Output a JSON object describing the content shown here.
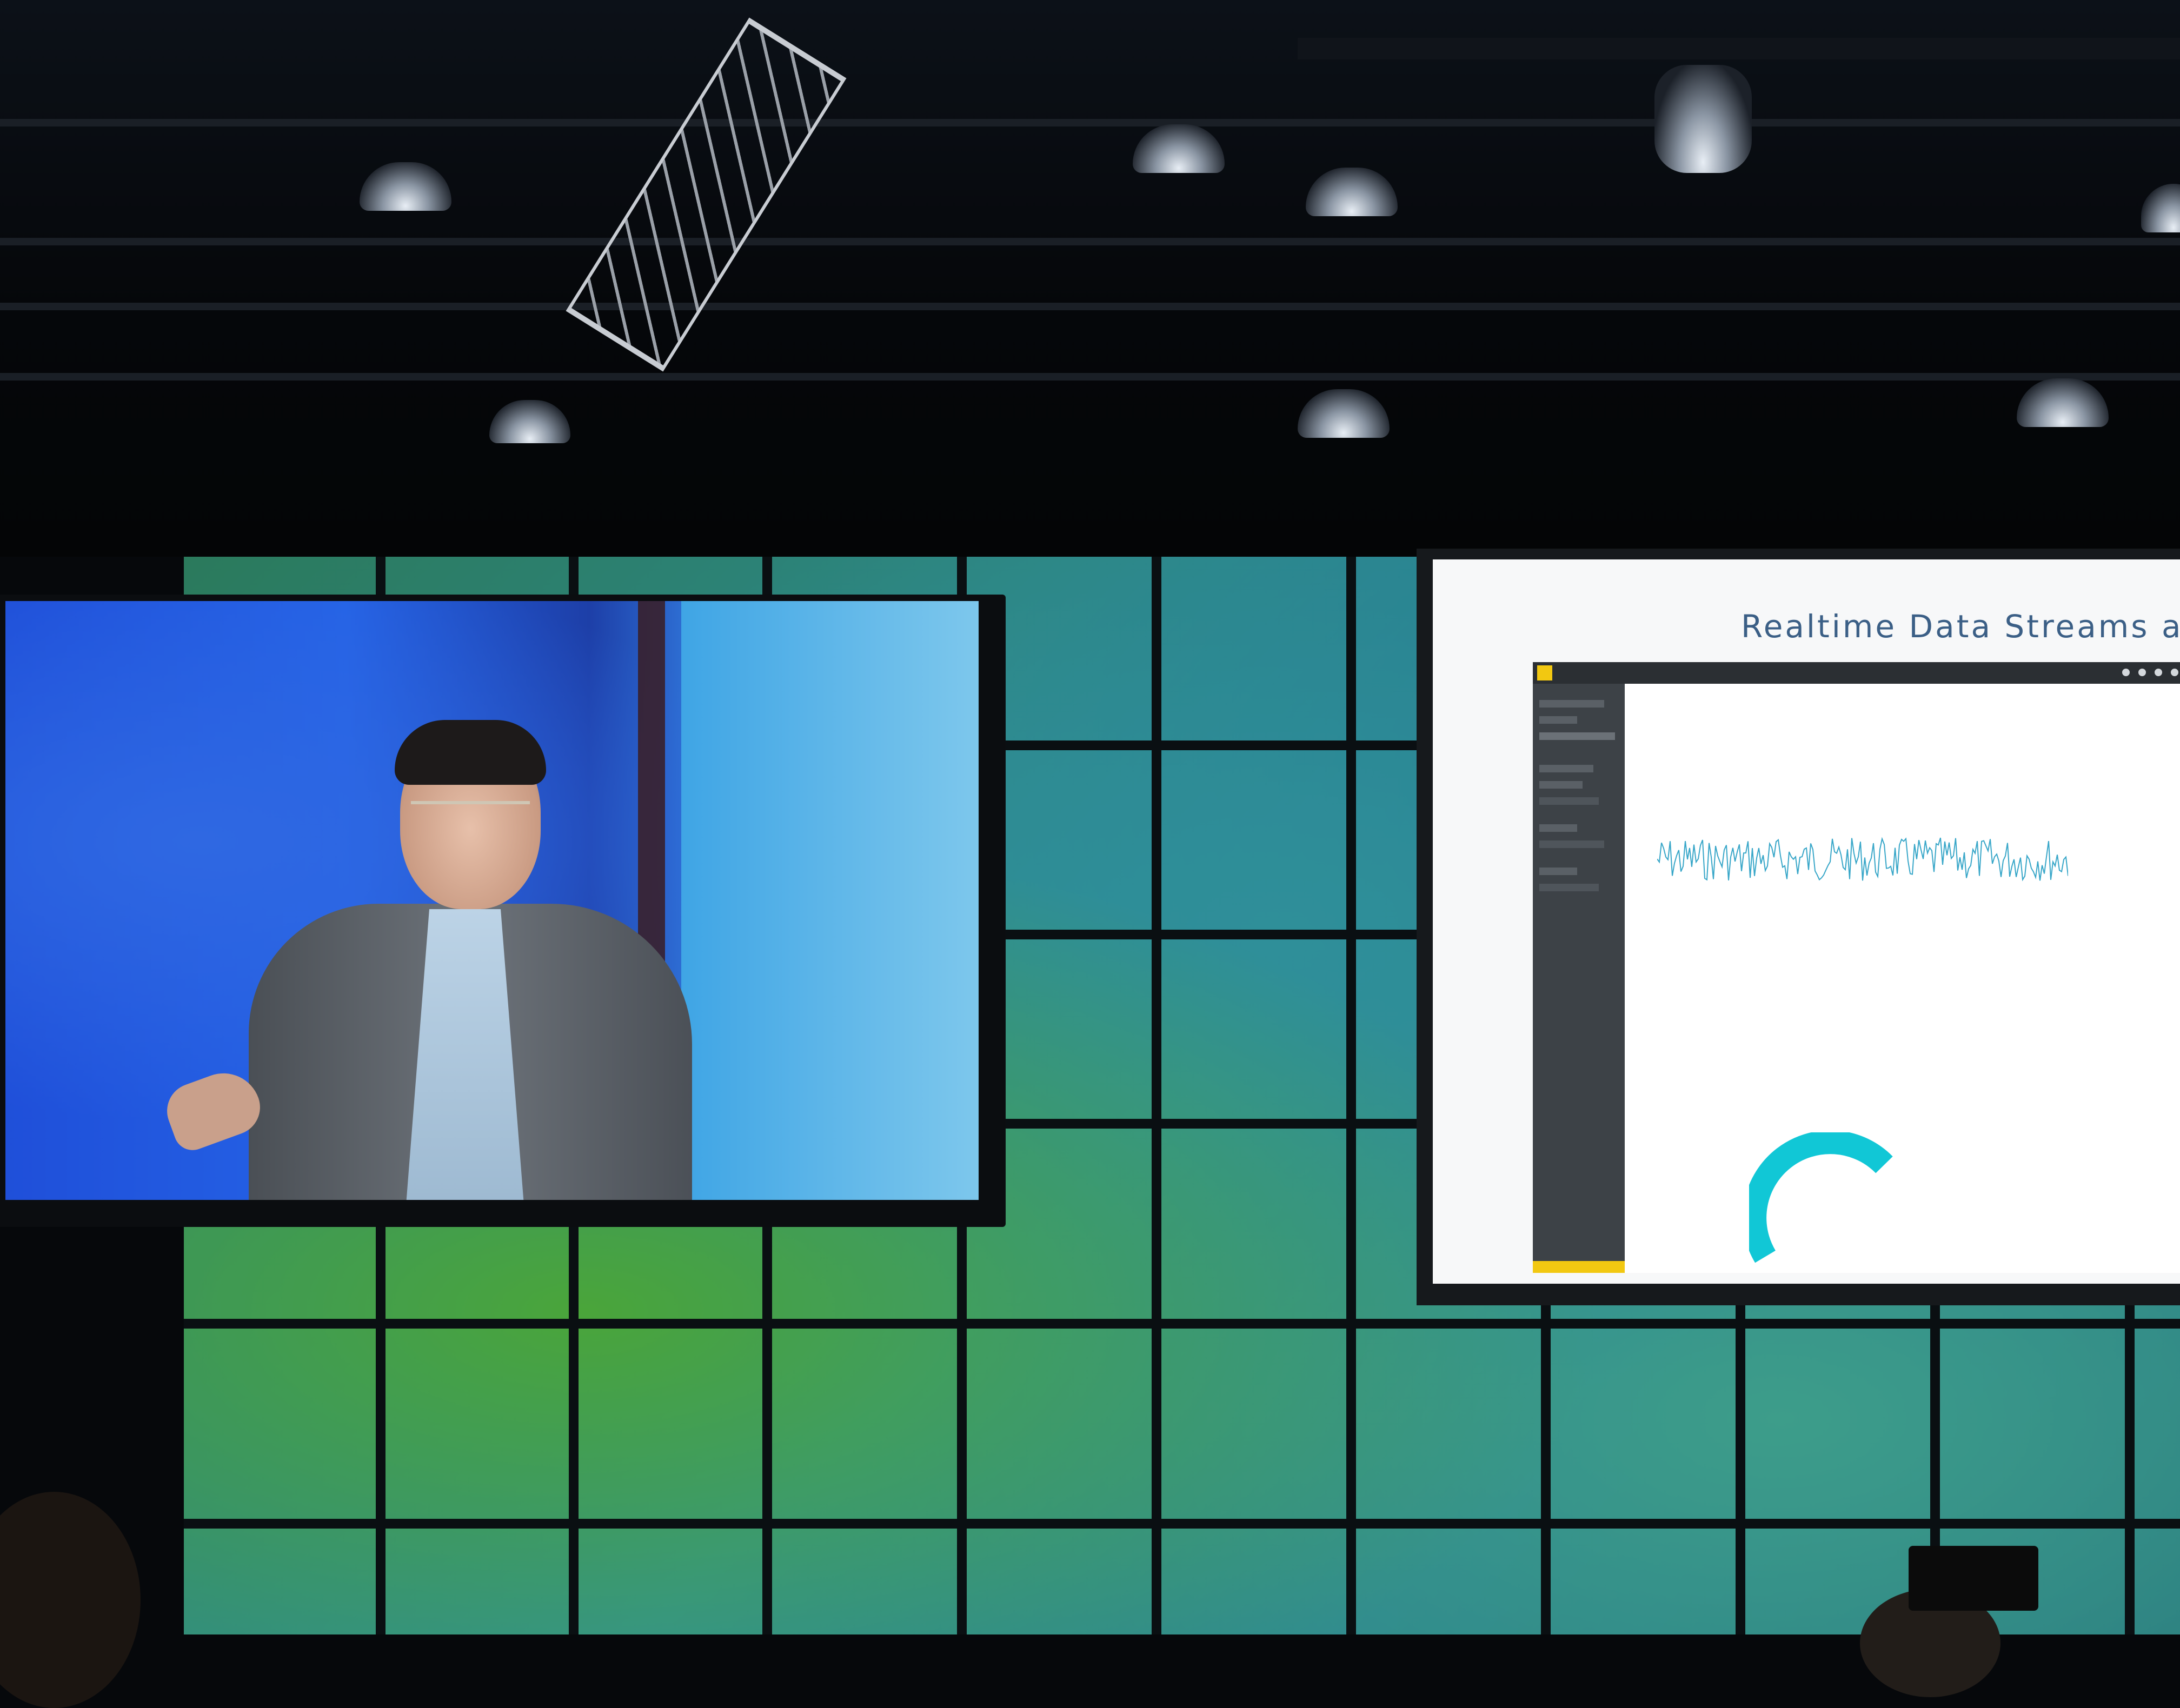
{
  "slide": {
    "title": "Realtime Data Streams a"
  },
  "app": {
    "accent_color": "#f2c811",
    "gauge_color": "#11c7d6",
    "chart_color": "#37a6c8"
  },
  "icons": [
    "power-bi-logo-icon",
    "settings-icon",
    "download-icon",
    "help-icon",
    "smiley-icon",
    "account-icon"
  ]
}
